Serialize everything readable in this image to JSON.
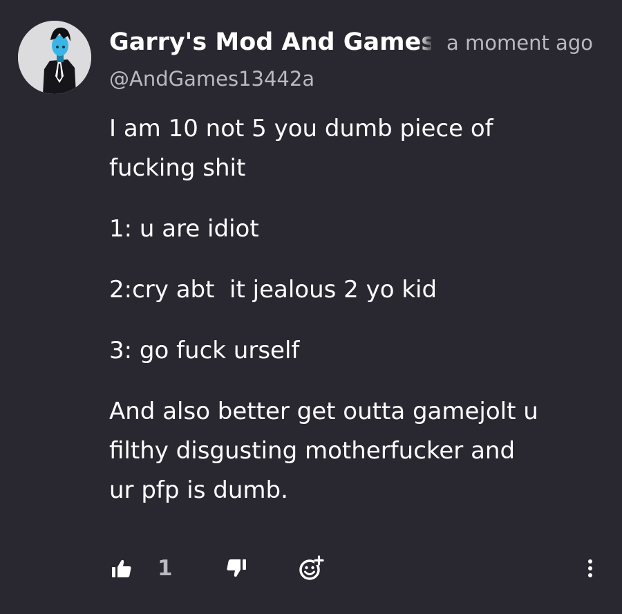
{
  "comment": {
    "author_name": "Garry's Mod And Games",
    "timestamp": "a moment ago",
    "author_handle": "@AndGames13442a",
    "paragraphs": [
      "I am 10 not 5 you dumb piece of\nfucking shit",
      "1: u are idiot",
      "2:cry abt  it jealous 2 yo kid",
      "3: go fuck urself",
      "And also better get outta gamejolt u\nfilthy disgusting motherfucker and\nur pfp is dumb."
    ],
    "likes": "1"
  },
  "icons": {
    "like": "thumbs-up-icon",
    "dislike": "thumbs-down-icon",
    "reaction": "add-reaction-icon",
    "more": "more-options-icon"
  },
  "colors": {
    "background": "#292730",
    "text": "#ffffff",
    "muted": "#b9b9bf"
  }
}
